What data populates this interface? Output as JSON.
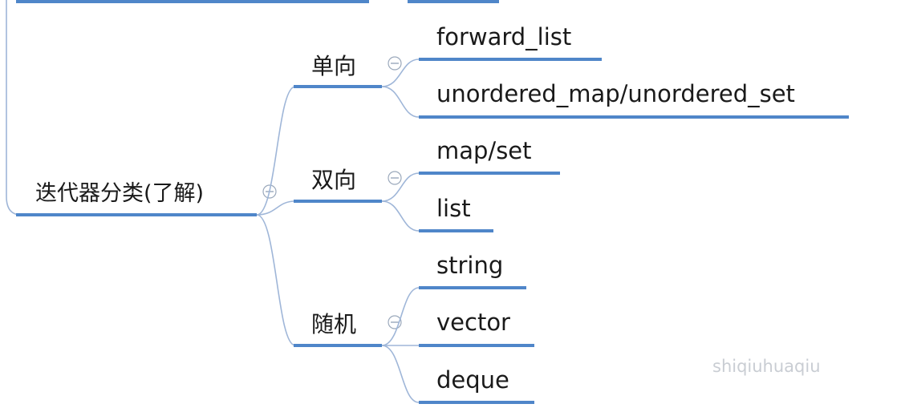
{
  "root": {
    "label": "迭代器分类(了解)"
  },
  "categories": [
    {
      "label": "单向",
      "items": [
        "forward_list",
        "unordered_map/unordered_set"
      ]
    },
    {
      "label": "双向",
      "items": [
        "map/set",
        "list"
      ]
    },
    {
      "label": "随机",
      "items": [
        "string",
        "vector",
        "deque"
      ]
    }
  ],
  "watermark": "shiqiuhuaqiu",
  "colors": {
    "underline": "#4f86c9",
    "connector": "#9fb6d8",
    "text": "#1a1a1a",
    "watermark": "#c9cdd3"
  },
  "icons": {
    "collapse": "minus-circle-icon"
  }
}
